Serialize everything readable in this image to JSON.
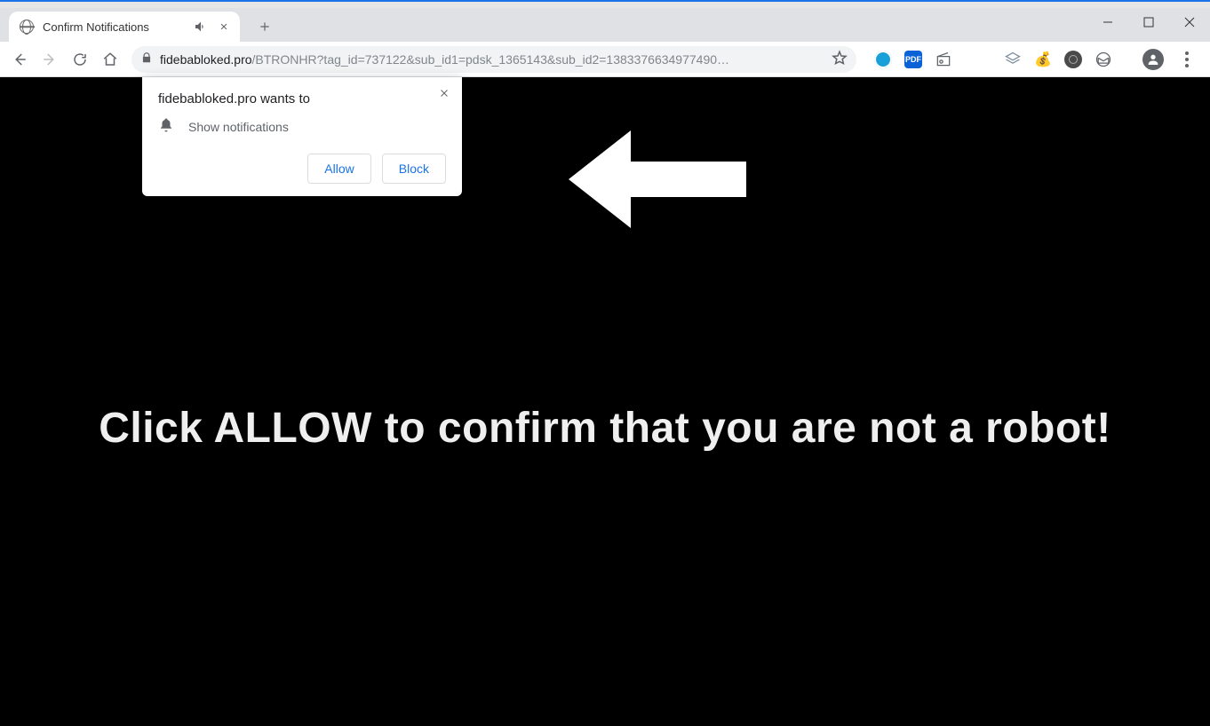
{
  "window": {
    "tab_title": "Confirm Notifications"
  },
  "address_bar": {
    "host": "fidebabloked.pro",
    "path": "/BTRONHR?tag_id=737122&sub_id1=pdsk_1365143&sub_id2=1383376634977490…"
  },
  "extensions": {
    "pdf_label": "PDF"
  },
  "permission_dialog": {
    "title": "fidebabloked.pro wants to",
    "body": "Show notifications",
    "allow": "Allow",
    "block": "Block"
  },
  "page": {
    "headline": "Click ALLOW to confirm that you are not a robot!"
  }
}
